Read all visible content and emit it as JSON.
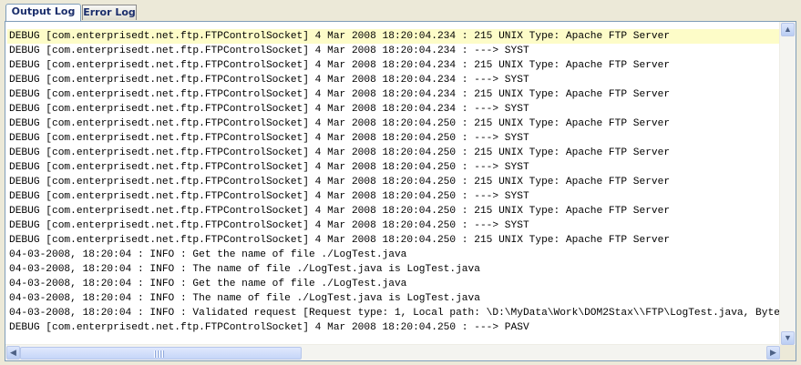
{
  "tabs": [
    {
      "label": "Output Log",
      "active": true
    },
    {
      "label": "Error Log",
      "active": false
    }
  ],
  "log_lines": [
    "DEBUG [com.enterprisedt.net.ftp.FTPControlSocket] 4 Mar 2008 18:20:04.234 : 215 UNIX Type: Apache FTP Server",
    "DEBUG [com.enterprisedt.net.ftp.FTPControlSocket] 4 Mar 2008 18:20:04.234 : ---> SYST",
    "DEBUG [com.enterprisedt.net.ftp.FTPControlSocket] 4 Mar 2008 18:20:04.234 : 215 UNIX Type: Apache FTP Server",
    "DEBUG [com.enterprisedt.net.ftp.FTPControlSocket] 4 Mar 2008 18:20:04.234 : ---> SYST",
    "DEBUG [com.enterprisedt.net.ftp.FTPControlSocket] 4 Mar 2008 18:20:04.234 : 215 UNIX Type: Apache FTP Server",
    "DEBUG [com.enterprisedt.net.ftp.FTPControlSocket] 4 Mar 2008 18:20:04.234 : ---> SYST",
    "DEBUG [com.enterprisedt.net.ftp.FTPControlSocket] 4 Mar 2008 18:20:04.250 : 215 UNIX Type: Apache FTP Server",
    "DEBUG [com.enterprisedt.net.ftp.FTPControlSocket] 4 Mar 2008 18:20:04.250 : ---> SYST",
    "DEBUG [com.enterprisedt.net.ftp.FTPControlSocket] 4 Mar 2008 18:20:04.250 : 215 UNIX Type: Apache FTP Server",
    "DEBUG [com.enterprisedt.net.ftp.FTPControlSocket] 4 Mar 2008 18:20:04.250 : ---> SYST",
    "DEBUG [com.enterprisedt.net.ftp.FTPControlSocket] 4 Mar 2008 18:20:04.250 : 215 UNIX Type: Apache FTP Server",
    "DEBUG [com.enterprisedt.net.ftp.FTPControlSocket] 4 Mar 2008 18:20:04.250 : ---> SYST",
    "DEBUG [com.enterprisedt.net.ftp.FTPControlSocket] 4 Mar 2008 18:20:04.250 : 215 UNIX Type: Apache FTP Server",
    "DEBUG [com.enterprisedt.net.ftp.FTPControlSocket] 4 Mar 2008 18:20:04.250 : ---> SYST",
    "DEBUG [com.enterprisedt.net.ftp.FTPControlSocket] 4 Mar 2008 18:20:04.250 : 215 UNIX Type: Apache FTP Server",
    "04-03-2008, 18:20:04 : INFO : Get the name of file ./LogTest.java",
    "04-03-2008, 18:20:04 : INFO : The name of file ./LogTest.java is LogTest.java",
    "04-03-2008, 18:20:04 : INFO : Get the name of file ./LogTest.java",
    "04-03-2008, 18:20:04 : INFO : The name of file ./LogTest.java is LogTest.java",
    "04-03-2008, 18:20:04 : INFO : Validated request [Request type: 1, Local path: \\D:\\MyData\\Work\\DOM2Stax\\\\FTP\\LogTest.java, Byte",
    "DEBUG [com.enterprisedt.net.ftp.FTPControlSocket] 4 Mar 2008 18:20:04.250 : ---> PASV"
  ],
  "icons": {
    "scroll_up": "▲",
    "scroll_down": "▼",
    "scroll_left": "◀",
    "scroll_right": "▶"
  }
}
